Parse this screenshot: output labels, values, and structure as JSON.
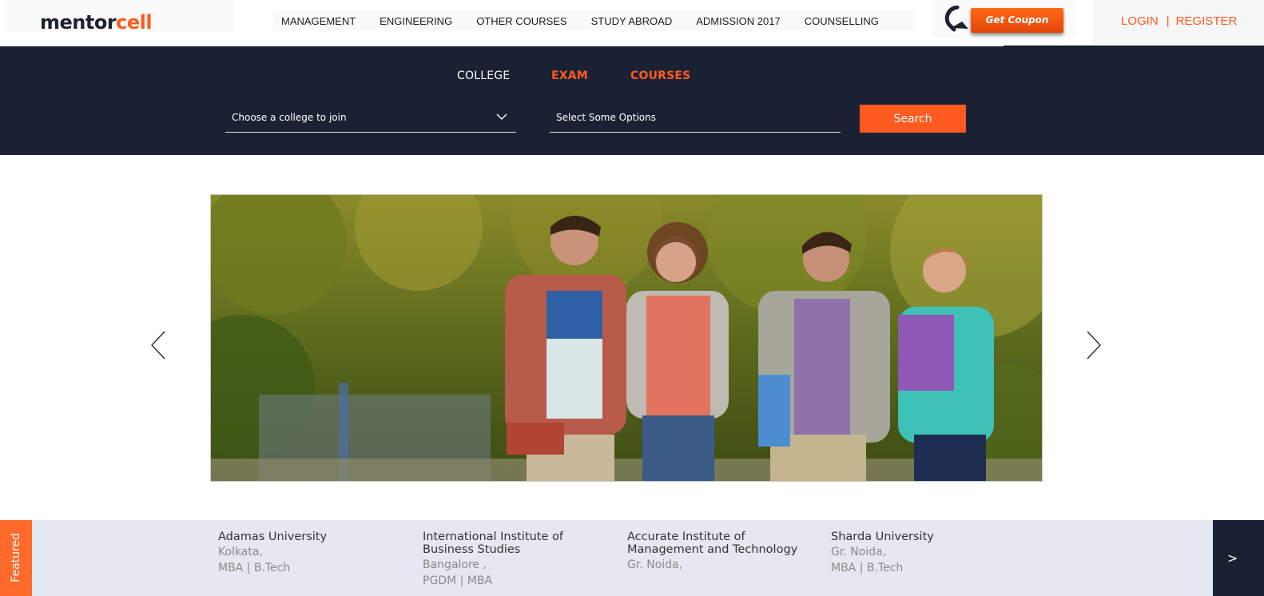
{
  "brand": {
    "logo_part1": "mentor",
    "logo_part2": "cell"
  },
  "nav": {
    "items": [
      {
        "label": "MANAGEMENT"
      },
      {
        "label": "ENGINEERING"
      },
      {
        "label": "OTHER COURSES"
      },
      {
        "label": "STUDY ABROAD"
      },
      {
        "label": "ADMISSION 2017"
      },
      {
        "label": "COUNSELLING"
      }
    ]
  },
  "coupon": {
    "label": "Get Coupon",
    "icon": "curved-arrow-icon"
  },
  "auth": {
    "login": "LOGIN",
    "separator": "|",
    "register": "REGISTER"
  },
  "search": {
    "tabs": [
      {
        "label": "COLLEGE"
      },
      {
        "label": "EXAM"
      },
      {
        "label": "COURSES"
      }
    ],
    "college_select": "Choose a college to join",
    "options_select": "Select Some Options",
    "button": "Search"
  },
  "hero": {
    "prev_icon": "chevron-left-icon",
    "next_icon": "chevron-right-icon"
  },
  "featured": {
    "tab_label": "Featured",
    "next_label": ">",
    "items": [
      {
        "name": "Adamas University",
        "city": "Kolkata,",
        "courses": "MBA | B.Tech"
      },
      {
        "name": "International Institute of Business Studies",
        "city": "Bangalore ,",
        "courses": "PGDM | MBA"
      },
      {
        "name": "Accurate Institute of Management and Technology",
        "city": "Gr. Noida,",
        "courses": ""
      },
      {
        "name": "Sharda University",
        "city": "Gr. Noida,",
        "courses": "MBA | B.Tech"
      }
    ]
  },
  "colors": {
    "accent": "#ff5a1f",
    "navy": "#1a2133",
    "featured_bg": "#e5e8f1"
  }
}
